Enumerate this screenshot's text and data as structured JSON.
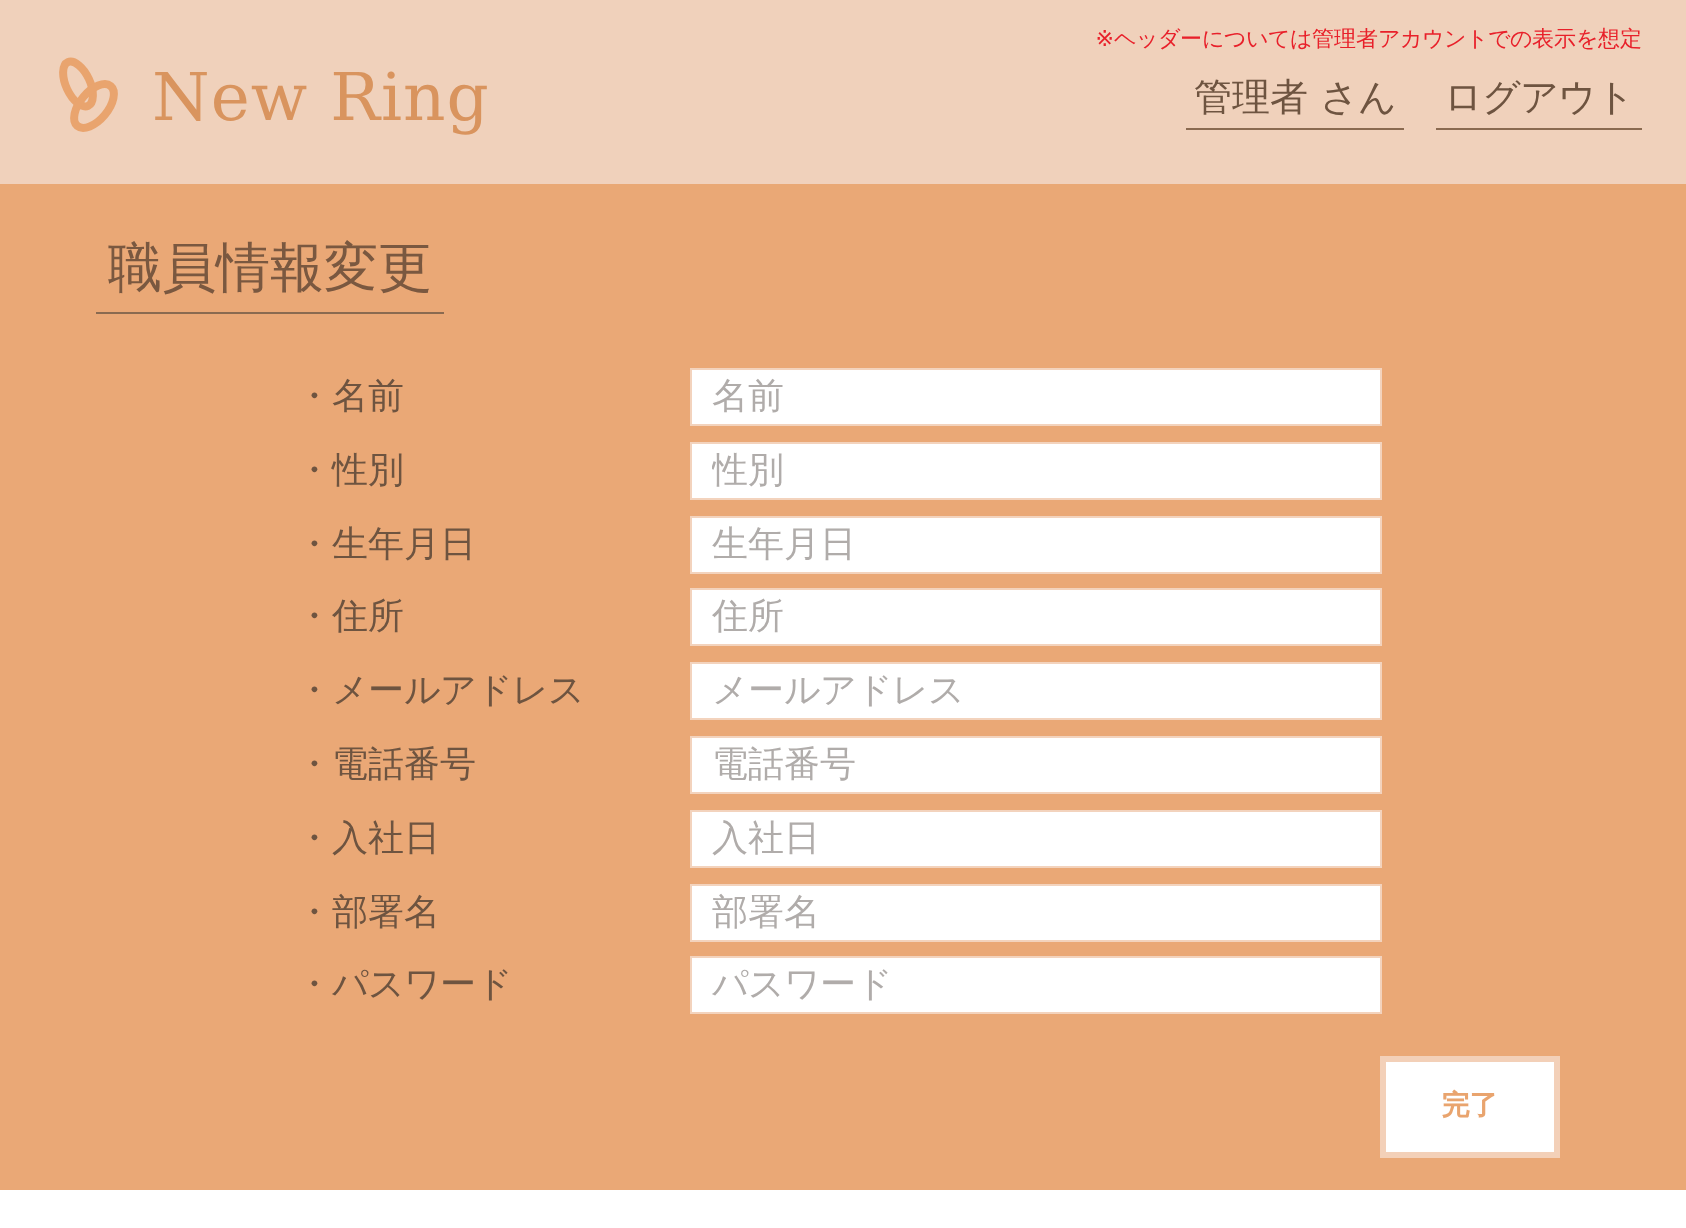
{
  "header": {
    "logo_text": "New Ring",
    "note": "※ヘッダーについては管理者アカウントでの表示を想定",
    "user_link": "管理者 さん",
    "logout_link": "ログアウト"
  },
  "page_title": "職員情報変更",
  "form": {
    "fields": [
      {
        "label": "・名前",
        "placeholder": "名前"
      },
      {
        "label": "・性別",
        "placeholder": "性別"
      },
      {
        "label": "・生年月日",
        "placeholder": "生年月日"
      },
      {
        "label": "・住所",
        "placeholder": "住所"
      },
      {
        "label": "・メールアドレス",
        "placeholder": "メールアドレス"
      },
      {
        "label": "・電話番号",
        "placeholder": "電話番号"
      },
      {
        "label": "・入社日",
        "placeholder": "入社日"
      },
      {
        "label": "・部署名",
        "placeholder": "部署名"
      },
      {
        "label": "・パスワード",
        "placeholder": "パスワード"
      }
    ]
  },
  "submit_button": "完了"
}
